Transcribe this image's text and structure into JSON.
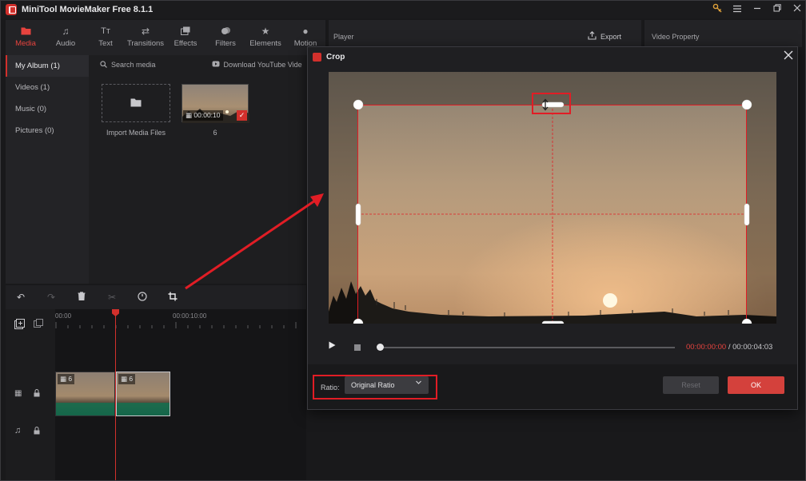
{
  "app": {
    "title": "MiniTool MovieMaker Free 8.1.1"
  },
  "window_controls": [
    "key-icon",
    "menu-icon",
    "minimize-icon",
    "restore-icon",
    "close-icon"
  ],
  "media_tabs": [
    {
      "label": "Media",
      "icon": "media-folder-icon",
      "active": true
    },
    {
      "label": "Audio",
      "icon": "audio-note-icon"
    },
    {
      "label": "Text",
      "icon": "text-icon"
    },
    {
      "label": "Transitions",
      "icon": "transitions-icon"
    },
    {
      "label": "Effects",
      "icon": "effects-icon"
    },
    {
      "label": "Filters",
      "icon": "filters-icon"
    },
    {
      "label": "Elements",
      "icon": "elements-icon"
    },
    {
      "label": "Motion",
      "icon": "motion-icon"
    }
  ],
  "sidebar": {
    "items": [
      {
        "label": "My Album  (1)",
        "active": true
      },
      {
        "label": "Videos  (1)"
      },
      {
        "label": "Music  (0)"
      },
      {
        "label": "Pictures  (0)"
      }
    ]
  },
  "media_toolbar": {
    "search_placeholder": "Search media",
    "download_label": "Download YouTube Vide"
  },
  "library": {
    "import_label": "Import Media Files",
    "clip": {
      "name": "6",
      "duration": "00:00:10",
      "selected": true
    }
  },
  "player": {
    "label": "Player",
    "export_label": "Export"
  },
  "property": {
    "label": "Video Property"
  },
  "timeline": {
    "toolbar_icons": [
      "undo-icon",
      "redo-icon",
      "delete-icon",
      "split-icon",
      "speed-icon",
      "crop-icon"
    ],
    "ruler_labels": [
      "00:00",
      "00:00:10:00"
    ],
    "clips": [
      {
        "label": "6"
      },
      {
        "label": "6"
      }
    ]
  },
  "crop_dialog": {
    "title": "Crop",
    "time_current": "00:00:00:00",
    "time_separator": " / ",
    "time_total": "00:00:04:03",
    "ratio_label": "Ratio:",
    "ratio_value": "Original Ratio",
    "reset_label": "Reset",
    "ok_label": "OK"
  },
  "colors": {
    "accent": "#d2302c",
    "annotation": "#e11d25",
    "background": "#19191b"
  }
}
